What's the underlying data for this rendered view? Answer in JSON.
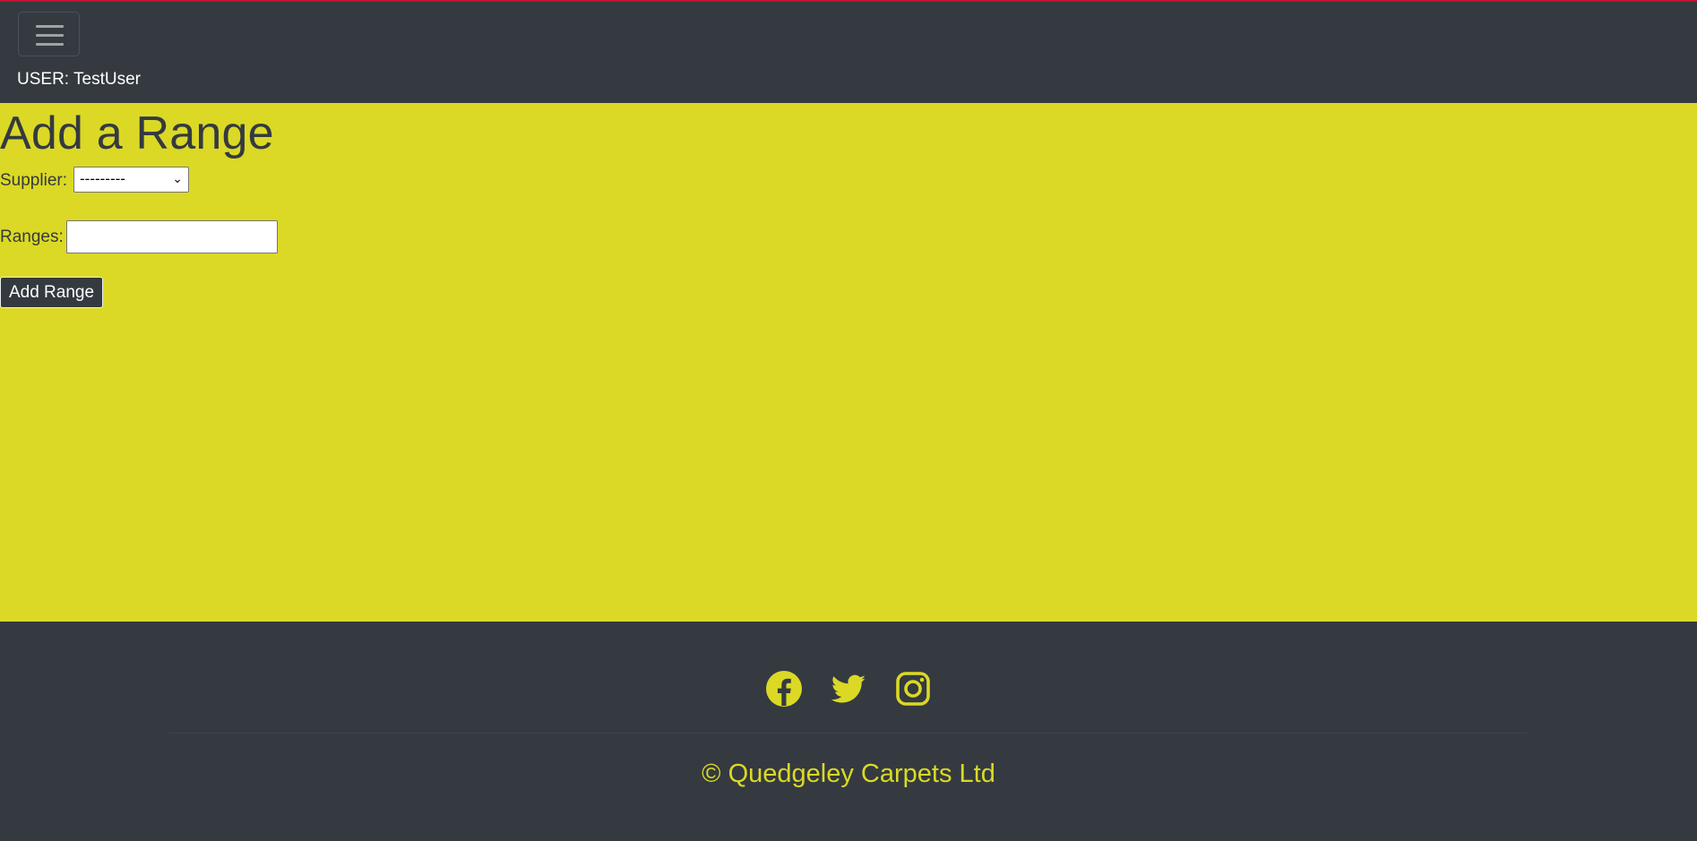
{
  "header": {
    "user_label": "USER: TestUser"
  },
  "main": {
    "title": "Add a Range",
    "supplier_label": "Supplier:",
    "supplier_selected": "---------",
    "ranges_label": "Ranges:",
    "ranges_value": "",
    "submit_label": "Add Range"
  },
  "footer": {
    "social_icons": [
      "facebook-icon",
      "twitter-icon",
      "instagram-icon"
    ],
    "copyright": "© Quedgeley Carpets Ltd"
  },
  "colors": {
    "brand_yellow": "#dbd925",
    "dark": "#343a40",
    "accent_red": "#c8102e"
  }
}
